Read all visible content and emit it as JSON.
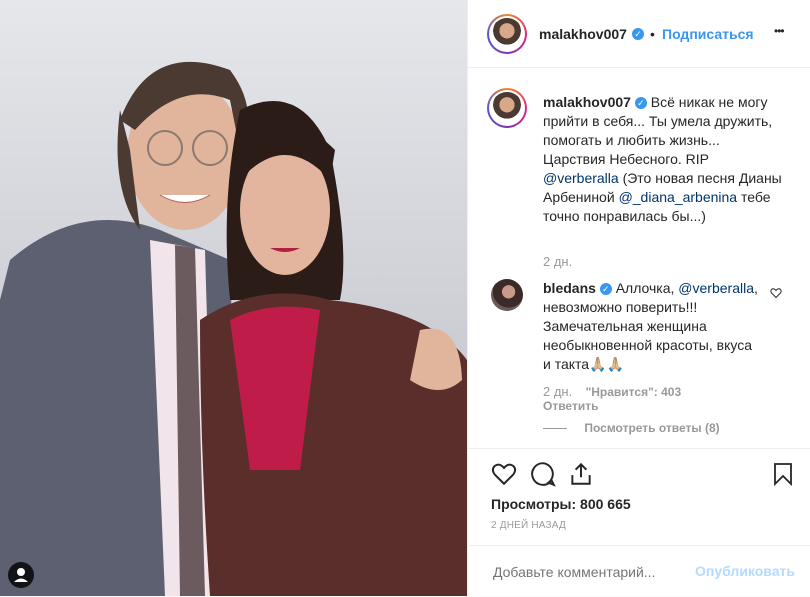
{
  "post": {
    "username": "malakhov007",
    "follow": "Подписаться",
    "dot": "•",
    "more": "•••",
    "caption_parts": {
      "text1": "Всё никак не могу прийти в себя... Ты умела дружить, помогать и любить жизнь... Царствия Небесного. RIP",
      "mention1": "@verberalla",
      "text2": "(Это новая песня Дианы Арбениной",
      "mention2": "@_diana_arbenina",
      "text3": "тебе точно понравилась бы...)"
    },
    "caption_time": "2 дн."
  },
  "comment": {
    "username": "bledans",
    "text1": "Аллочка,",
    "mention": "@verberalla",
    "text2": ", невозможно поверить!!! Замечательная женщина необыкновенной красоты, вкуса и такта🙏🏼🙏🏼",
    "time": "2 дн.",
    "likes": "\"Нравится\": 403",
    "reply": "Ответить",
    "view_replies": "Посмотреть ответы (8)"
  },
  "views": "Просмотры: 800 665",
  "date": "2 ДНЕЙ НАЗАД",
  "add_comment": {
    "placeholder": "Добавьте комментарий...",
    "publish": "Опубликовать"
  },
  "icons": {
    "like": "heart-icon",
    "comment": "comment-icon",
    "share": "share-icon",
    "save": "bookmark-icon",
    "tagged": "user-tag-icon"
  },
  "colors": {
    "accent": "#3897f0",
    "text": "#262626",
    "muted": "#999999"
  }
}
